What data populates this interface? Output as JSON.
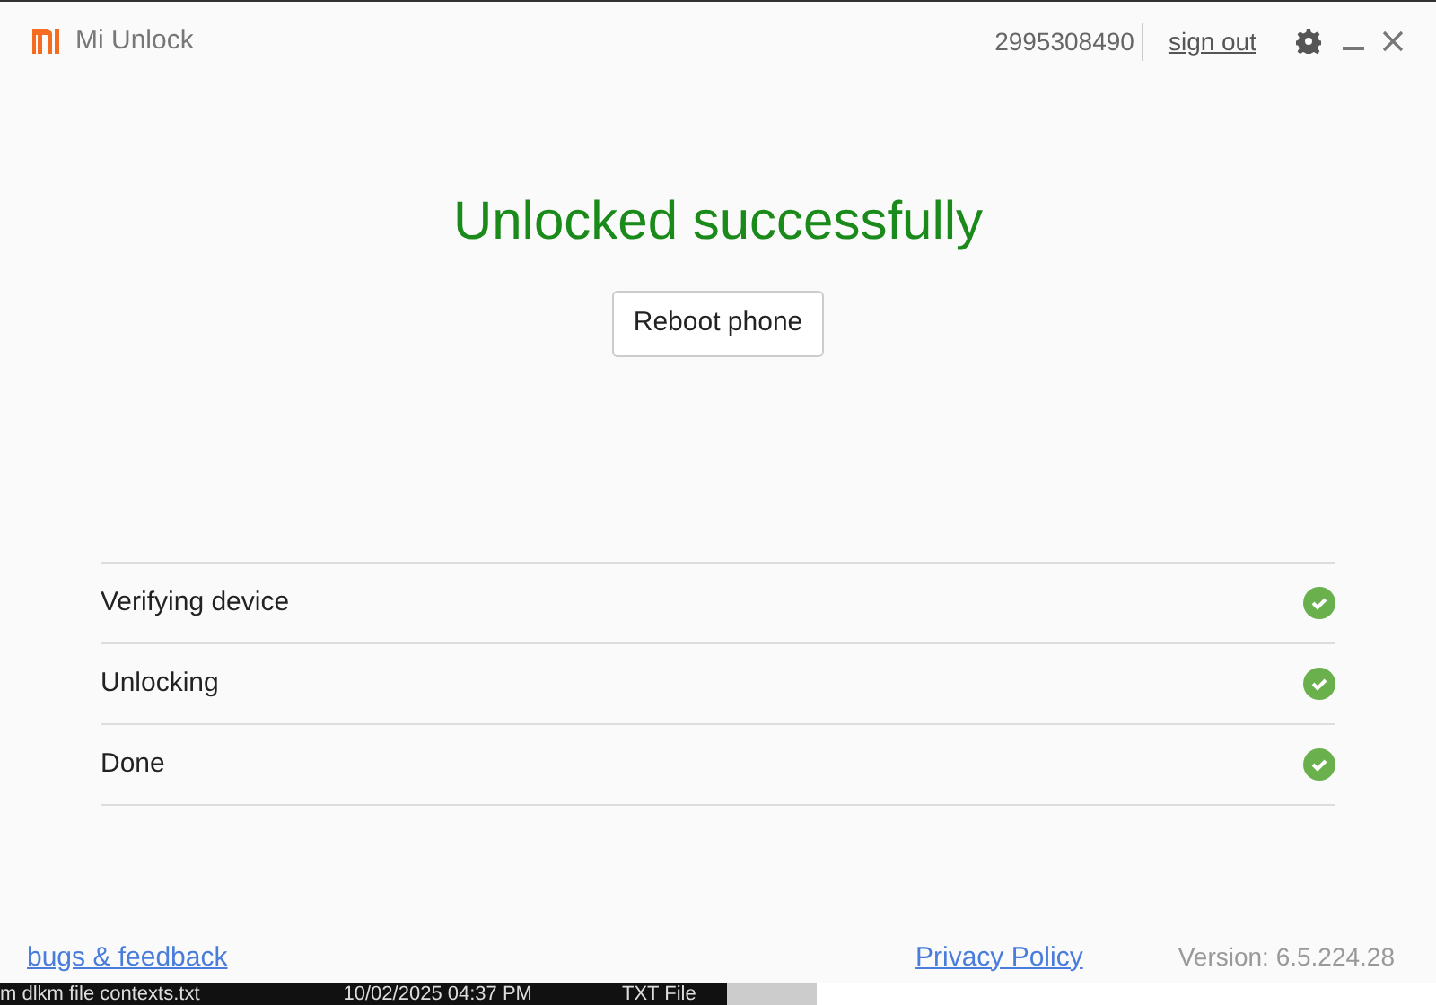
{
  "window": {
    "title": "Mi Unlock",
    "account": "2995308490",
    "sign_out": "sign out"
  },
  "status": {
    "heading": "Unlocked successfully",
    "button": "Reboot phone"
  },
  "steps": [
    {
      "label": "Verifying device",
      "done": true
    },
    {
      "label": "Unlocking",
      "done": true
    },
    {
      "label": "Done",
      "done": true
    }
  ],
  "footer": {
    "feedback": "bugs & feedback",
    "privacy": "Privacy Policy",
    "version": "Version: 6.5.224.28"
  },
  "background_window": {
    "file_name": "m dlkm file contexts.txt",
    "date": "10/02/2025 04:37 PM",
    "type": "TXT File"
  }
}
